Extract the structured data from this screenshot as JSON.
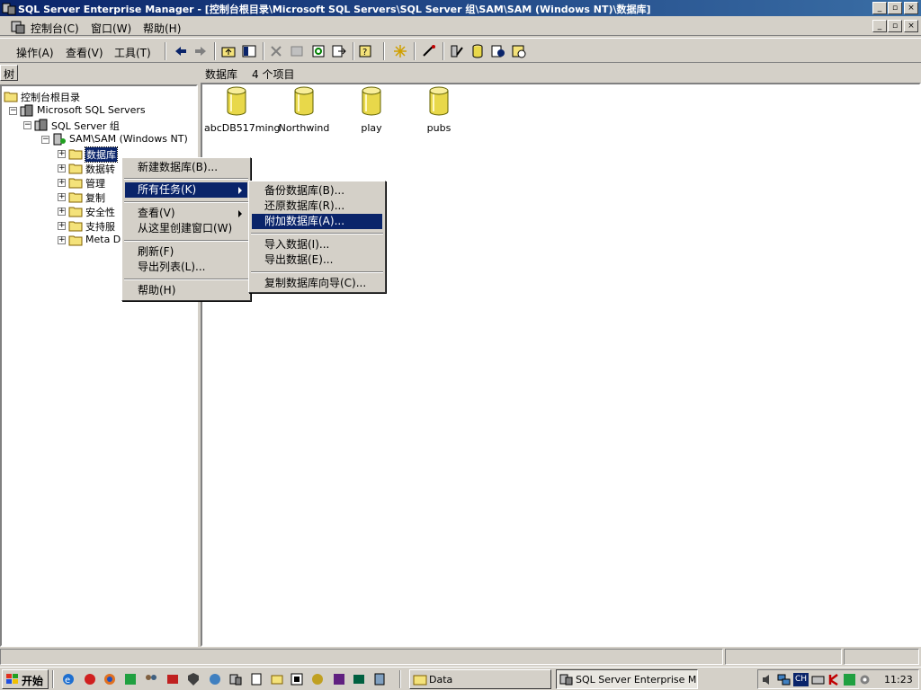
{
  "window": {
    "title": "SQL Server Enterprise Manager - [控制台根目录\\Microsoft SQL Servers\\SQL Server 组\\SAM\\SAM (Windows NT)\\数据库]",
    "caption_buttons": [
      "_",
      "▫",
      "×"
    ]
  },
  "menubar": {
    "items": [
      "控制台(C)",
      "窗口(W)",
      "帮助(H)"
    ],
    "mdi_buttons": [
      "_",
      "▫",
      "×"
    ]
  },
  "toolbar": {
    "items": [
      "操作(A)",
      "查看(V)",
      "工具(T)"
    ],
    "icons": [
      "back-arrow-icon",
      "forward-arrow-icon",
      "up-folder-icon",
      "show-tree-icon",
      "delete-icon",
      "properties-icon",
      "refresh-icon",
      "export-icon",
      "help-icon",
      "wizard-icon",
      "register-server-icon",
      "new-login-icon",
      "new-database-icon",
      "new-job-icon",
      "new-alert-icon"
    ]
  },
  "tree": {
    "tab_label": "树",
    "items": [
      {
        "label": "控制台根目录",
        "level": 0,
        "expander": "",
        "icon": "folder-icon"
      },
      {
        "label": "Microsoft SQL Servers",
        "level": 1,
        "expander": "−",
        "icon": "server-group-icon"
      },
      {
        "label": "SQL Server 组",
        "level": 2,
        "expander": "−",
        "icon": "server-group-icon"
      },
      {
        "label": "SAM\\SAM (Windows NT)",
        "level": 3,
        "expander": "−",
        "icon": "server-icon"
      },
      {
        "label": "数据库",
        "level": 4,
        "expander": "+",
        "icon": "folder-icon",
        "selected": true
      },
      {
        "label": "数据转",
        "level": 4,
        "expander": "+",
        "icon": "folder-icon"
      },
      {
        "label": "管理",
        "level": 4,
        "expander": "+",
        "icon": "folder-icon"
      },
      {
        "label": "复制",
        "level": 4,
        "expander": "+",
        "icon": "folder-icon"
      },
      {
        "label": "安全性",
        "level": 4,
        "expander": "+",
        "icon": "folder-icon"
      },
      {
        "label": "支持服",
        "level": 4,
        "expander": "+",
        "icon": "folder-icon"
      },
      {
        "label": "Meta D",
        "level": 4,
        "expander": "+",
        "icon": "folder-icon"
      }
    ]
  },
  "list": {
    "title": "数据库",
    "count": "4 个项目",
    "items": [
      "abcDB517ming",
      "Northwind",
      "play",
      "pubs"
    ]
  },
  "context_menu": {
    "items": [
      {
        "label": "新建数据库(B)..."
      },
      {
        "label": "所有任务(K)",
        "submenu": true,
        "selected": true
      },
      {
        "label": "查看(V)",
        "submenu": true
      },
      {
        "label": "从这里创建窗口(W)"
      },
      {
        "label": "刷新(F)"
      },
      {
        "label": "导出列表(L)..."
      },
      {
        "label": "帮助(H)"
      }
    ]
  },
  "submenu": {
    "items": [
      {
        "label": "备份数据库(B)..."
      },
      {
        "label": "还原数据库(R)..."
      },
      {
        "label": "附加数据库(A)...",
        "selected": true
      },
      {
        "label": "导入数据(I)..."
      },
      {
        "label": "导出数据(E)..."
      },
      {
        "label": "复制数据库向导(C)..."
      }
    ]
  },
  "taskbar": {
    "start_label": "开始",
    "tasks": [
      {
        "label": "Data",
        "icon": "folder-icon"
      },
      {
        "label": "SQL Server Enterprise Ma...",
        "icon": "enterprise-manager-icon",
        "active": true
      }
    ],
    "tray_icons": [
      "volume-icon",
      "network-icon",
      "ime-ch-icon",
      "keyboard-icon",
      "kaspersky-icon",
      "g-icon",
      "settings-icon"
    ],
    "ime_label": "CH",
    "clock": "11:23"
  },
  "colors": {
    "titlebar": "#0a246a",
    "selection": "#0a246a",
    "face": "#d4d0c8",
    "db_yellow": "#e8d84a"
  }
}
